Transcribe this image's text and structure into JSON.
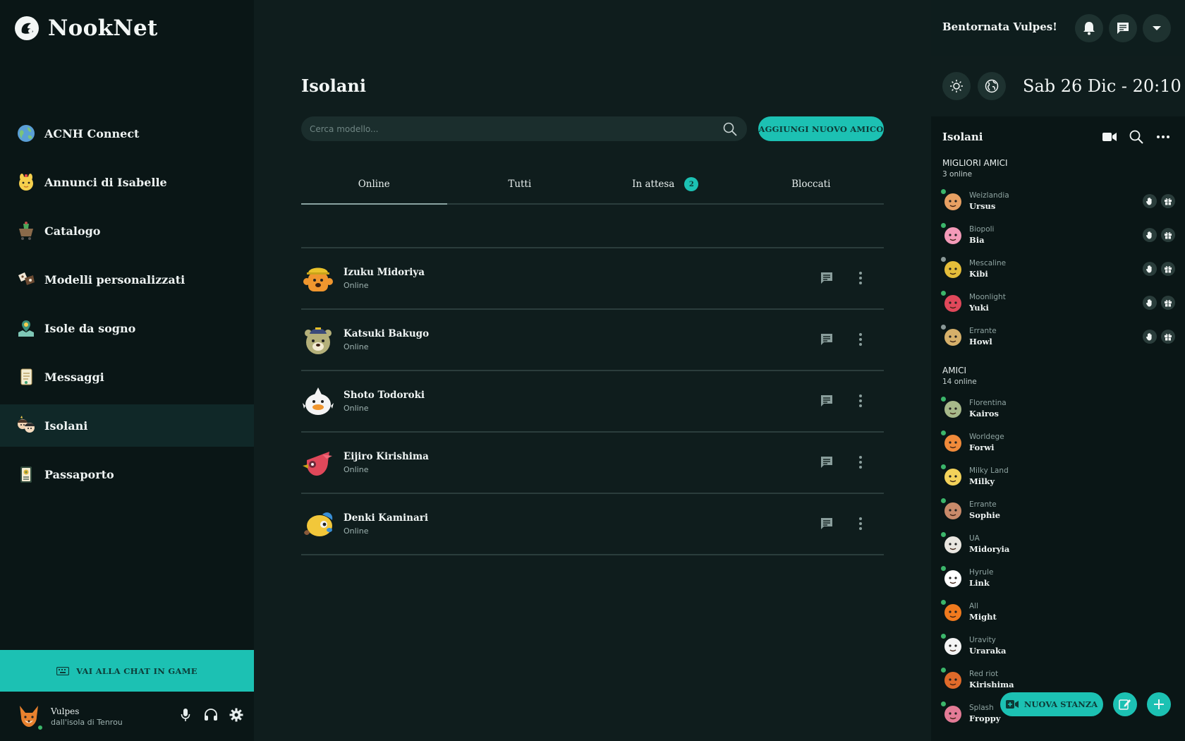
{
  "app": {
    "name": "NookNet"
  },
  "sidebar": {
    "items": [
      {
        "label": "ACNH Connect",
        "icon": "globe-icon"
      },
      {
        "label": "Annunci di Isabelle",
        "icon": "isabelle-icon"
      },
      {
        "label": "Catalogo",
        "icon": "catalog-cart-icon"
      },
      {
        "label": "Modelli personalizzati",
        "icon": "custom-designs-icon"
      },
      {
        "label": "Isole da sogno",
        "icon": "dream-island-icon"
      },
      {
        "label": "Messaggi",
        "icon": "message-scroll-icon"
      },
      {
        "label": "Isolani",
        "icon": "islanders-icon"
      },
      {
        "label": "Passaporto",
        "icon": "passport-icon"
      }
    ],
    "active_index": 6,
    "game_chat_label": "VAI ALLA CHAT IN GAME",
    "user": {
      "name": "Vulpes",
      "island": "dall'isola di Tenrou",
      "status_color": "#3bb56a"
    }
  },
  "main": {
    "title": "Isolani",
    "search_placeholder": "Cerca modello...",
    "add_friend_label": "AGGIUNGI NUOVO AMICO",
    "tabs": [
      {
        "label": "Online",
        "active": true
      },
      {
        "label": "Tutti"
      },
      {
        "label": "In attesa",
        "badge": "2"
      },
      {
        "label": "Bloccati"
      }
    ],
    "friends": [
      {
        "name": "Izuku Midoriya",
        "status": "Online",
        "avatar": "villager-orange-hardhat-icon"
      },
      {
        "name": "Katsuki Bakugo",
        "status": "Online",
        "avatar": "villager-bear-cap-icon"
      },
      {
        "name": "Shoto Todoroki",
        "status": "Online",
        "avatar": "villager-white-bird-icon"
      },
      {
        "name": "Eijiro Kirishima",
        "status": "Online",
        "avatar": "villager-red-eagle-icon"
      },
      {
        "name": "Denki Kaminari",
        "status": "Online",
        "avatar": "villager-yellow-fish-icon"
      }
    ]
  },
  "right": {
    "welcome": "Bentornata Vulpes!",
    "clock": "Sab 26 Dic - 20:10",
    "panel_title": "Isolani",
    "best_friends": {
      "title": "MIGLIORI AMICI",
      "count": "3 online",
      "items": [
        {
          "island": "Weizlandia",
          "name": "Ursus",
          "online": true,
          "avatar_color": "#e7a063"
        },
        {
          "island": "Biopoli",
          "name": "Bia",
          "online": true,
          "avatar_color": "#f39ab8"
        },
        {
          "island": "Mescaline",
          "name": "Kibi",
          "online": false,
          "avatar_color": "#e4bd3a"
        },
        {
          "island": "Moonlight",
          "name": "Yuki",
          "online": true,
          "avatar_color": "#e0485a"
        },
        {
          "island": "Errante",
          "name": "Howl",
          "online": false,
          "avatar_color": "#d6b06a"
        }
      ]
    },
    "friends": {
      "title": "AMICI",
      "count": "14 online",
      "items": [
        {
          "island": "Florentina",
          "name": "Kairos",
          "online": true,
          "avatar_color": "#a7b98a"
        },
        {
          "island": "Worldege",
          "name": "Forwi",
          "online": true,
          "avatar_color": "#f08a3a"
        },
        {
          "island": "Milky Land",
          "name": "Milky",
          "online": true,
          "avatar_color": "#f3d25a"
        },
        {
          "island": "Errante",
          "name": "Sophie",
          "online": true,
          "avatar_color": "#c98a6a"
        },
        {
          "island": "UA",
          "name": "Midoryia",
          "online": true,
          "avatar_color": "#e9e6e0"
        },
        {
          "island": "Hyrule",
          "name": "Link",
          "online": true,
          "avatar_color": "#ffffff"
        },
        {
          "island": "All",
          "name": "Might",
          "online": true,
          "avatar_color": "#f07a1e"
        },
        {
          "island": "Uravity",
          "name": "Uraraka",
          "online": true,
          "avatar_color": "#f4f4f4"
        },
        {
          "island": "Red riot",
          "name": "Kirishima",
          "online": true,
          "avatar_color": "#e06a2a"
        },
        {
          "island": "Splash",
          "name": "Froppy",
          "online": true,
          "avatar_color": "#e37b96"
        }
      ]
    },
    "new_room_label": "NUOVA STANZA"
  }
}
